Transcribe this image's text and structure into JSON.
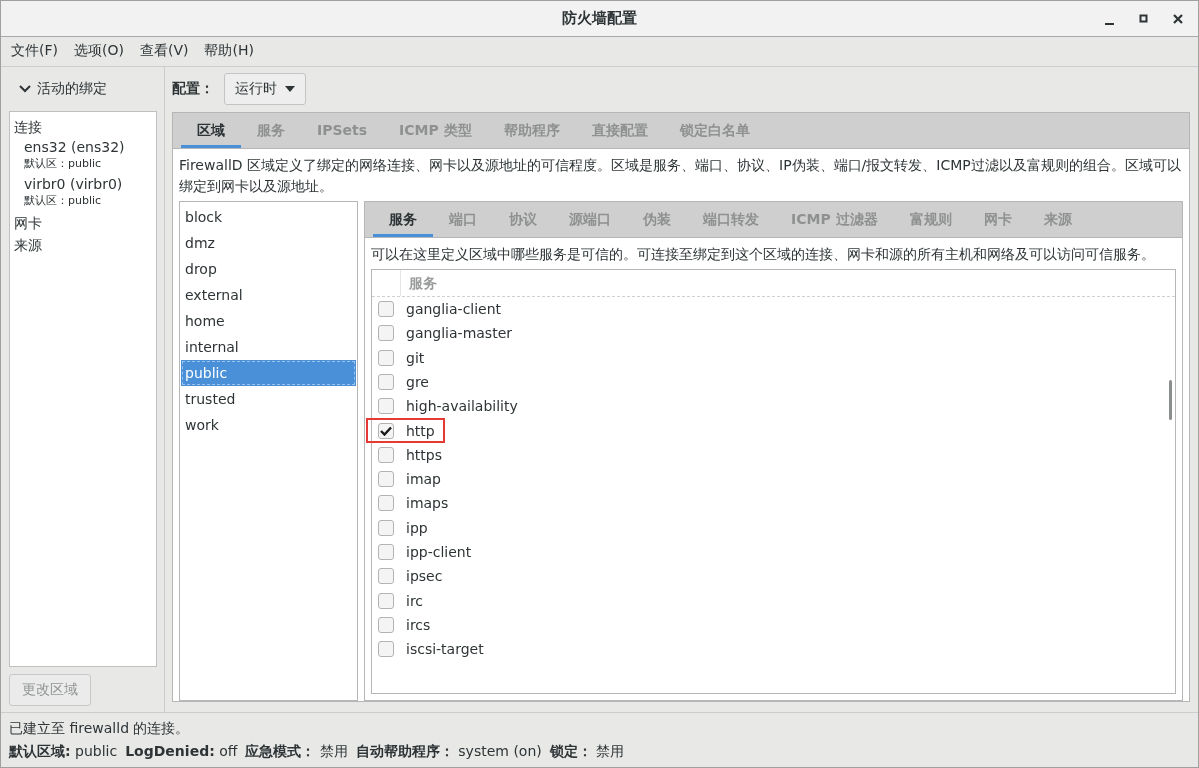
{
  "window": {
    "title": "防火墙配置"
  },
  "menu": [
    "文件(F)",
    "选项(O)",
    "查看(V)",
    "帮助(H)"
  ],
  "sidebar": {
    "header": "活动的绑定",
    "expanded": true,
    "sections": [
      {
        "label": "连接",
        "items": [
          {
            "name": "ens32 (ens32)",
            "zone_label": "默认区：",
            "zone": "public"
          },
          {
            "name": "virbr0 (virbr0)",
            "zone_label": "默认区：",
            "zone": "public"
          }
        ]
      },
      {
        "label": "网卡"
      },
      {
        "label": "来源"
      }
    ]
  },
  "change_zone_button": {
    "label": "更改区域",
    "disabled": true
  },
  "configuration": {
    "label": "配置：",
    "value": "运行时"
  },
  "main_tabs": [
    {
      "label": "区域",
      "selected": true
    },
    {
      "label": "服务",
      "selected": false
    },
    {
      "label": "IPSets",
      "selected": false
    },
    {
      "label": "ICMP 类型",
      "selected": false
    },
    {
      "label": "帮助程序",
      "selected": false
    },
    {
      "label": "直接配置",
      "selected": false
    },
    {
      "label": "锁定白名单",
      "selected": false
    }
  ],
  "zones_description": "FirewallD 区域定义了绑定的网络连接、网卡以及源地址的可信程度。区域是服务、端口、协议、IP伪装、端口/报文转发、ICMP过滤以及富规则的组合。区域可以绑定到网卡以及源地址。",
  "zones": [
    {
      "name": "block",
      "selected": false
    },
    {
      "name": "dmz",
      "selected": false
    },
    {
      "name": "drop",
      "selected": false
    },
    {
      "name": "external",
      "selected": false
    },
    {
      "name": "home",
      "selected": false
    },
    {
      "name": "internal",
      "selected": false
    },
    {
      "name": "public",
      "selected": true
    },
    {
      "name": "trusted",
      "selected": false
    },
    {
      "name": "work",
      "selected": false
    }
  ],
  "zone_tabs": [
    {
      "label": "服务",
      "selected": true
    },
    {
      "label": "端口",
      "selected": false
    },
    {
      "label": "协议",
      "selected": false
    },
    {
      "label": "源端口",
      "selected": false
    },
    {
      "label": "伪装",
      "selected": false
    },
    {
      "label": "端口转发",
      "selected": false
    },
    {
      "label": "ICMP 过滤器",
      "selected": false
    },
    {
      "label": "富规则",
      "selected": false
    },
    {
      "label": "网卡",
      "selected": false
    },
    {
      "label": "来源",
      "selected": false
    }
  ],
  "services_description": "可以在这里定义区域中哪些服务是可信的。可连接至绑定到这个区域的连接、网卡和源的所有主机和网络及可以访问可信服务。",
  "services_table": {
    "column": "服务",
    "rows": [
      {
        "name": "ganglia-client",
        "checked": false,
        "highlighted": false
      },
      {
        "name": "ganglia-master",
        "checked": false,
        "highlighted": false
      },
      {
        "name": "git",
        "checked": false,
        "highlighted": false
      },
      {
        "name": "gre",
        "checked": false,
        "highlighted": false
      },
      {
        "name": "high-availability",
        "checked": false,
        "highlighted": false
      },
      {
        "name": "http",
        "checked": true,
        "highlighted": true
      },
      {
        "name": "https",
        "checked": false,
        "highlighted": false
      },
      {
        "name": "imap",
        "checked": false,
        "highlighted": false
      },
      {
        "name": "imaps",
        "checked": false,
        "highlighted": false
      },
      {
        "name": "ipp",
        "checked": false,
        "highlighted": false
      },
      {
        "name": "ipp-client",
        "checked": false,
        "highlighted": false
      },
      {
        "name": "ipsec",
        "checked": false,
        "highlighted": false
      },
      {
        "name": "irc",
        "checked": false,
        "highlighted": false
      },
      {
        "name": "ircs",
        "checked": false,
        "highlighted": false
      },
      {
        "name": "iscsi-target",
        "checked": false,
        "highlighted": false
      }
    ]
  },
  "status": {
    "message": "已建立至 firewalld 的连接。",
    "fields": [
      {
        "label": "默认区域:",
        "value": "public"
      },
      {
        "label": "LogDenied:",
        "value": "off"
      },
      {
        "label": "应急模式：",
        "value": "禁用"
      },
      {
        "label": "自动帮助程序：",
        "value": "system (on)"
      },
      {
        "label": "锁定：",
        "value": "禁用"
      }
    ]
  }
}
